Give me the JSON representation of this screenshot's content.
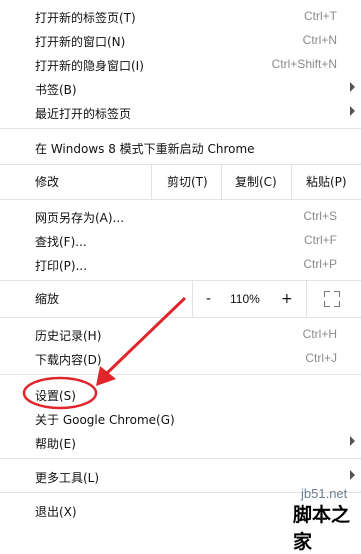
{
  "menu": {
    "new_tab": {
      "label": "打开新的标签页(T)",
      "shortcut": "Ctrl+T"
    },
    "new_window": {
      "label": "打开新的窗口(N)",
      "shortcut": "Ctrl+N"
    },
    "new_incognito": {
      "label": "打开新的隐身窗口(I)",
      "shortcut": "Ctrl+Shift+N"
    },
    "bookmarks": {
      "label": "书签(B)"
    },
    "recent_tabs": {
      "label": "最近打开的标签页"
    },
    "relaunch": {
      "label": "在 Windows 8 模式下重新启动 Chrome"
    },
    "edit": {
      "label": "修改",
      "cut": "剪切(T)",
      "copy": "复制(C)",
      "paste": "粘贴(P)"
    },
    "save_as": {
      "label": "网页另存为(A)...",
      "shortcut": "Ctrl+S"
    },
    "find": {
      "label": "查找(F)...",
      "shortcut": "Ctrl+F"
    },
    "print": {
      "label": "打印(P)...",
      "shortcut": "Ctrl+P"
    },
    "zoom": {
      "label": "缩放",
      "minus": "-",
      "value": "110%",
      "plus": "+"
    },
    "history": {
      "label": "历史记录(H)",
      "shortcut": "Ctrl+H"
    },
    "downloads": {
      "label": "下载内容(D)",
      "shortcut": "Ctrl+J"
    },
    "settings": {
      "label": "设置(S)"
    },
    "about": {
      "label": "关于 Google Chrome(G)"
    },
    "help": {
      "label": "帮助(E)"
    },
    "more_tools": {
      "label": "更多工具(L)"
    },
    "exit": {
      "label": "退出(X)"
    }
  },
  "annotation": {
    "color": "#e0262b"
  },
  "watermark": {
    "site": "jb51.net",
    "name": "脚本之家"
  }
}
